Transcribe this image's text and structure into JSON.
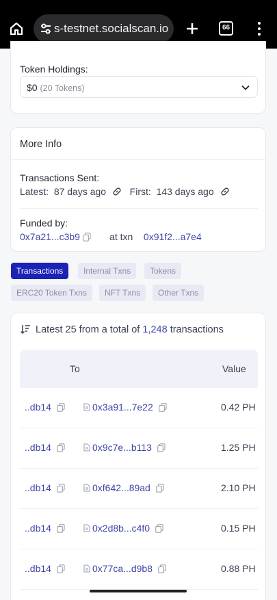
{
  "browser": {
    "url": "s-testnet.socialscan.io",
    "tab_count": "66",
    "icons": [
      "home-icon",
      "tune-icon",
      "plus-icon",
      "tab-switcher-icon",
      "more-vertical-icon"
    ]
  },
  "token_holdings": {
    "label": "Token Holdings:",
    "value": "$0",
    "count": "(20 Tokens)"
  },
  "more_info": {
    "title": "More Info",
    "tx_sent_label": "Transactions Sent:",
    "latest_label": "Latest:",
    "latest_value": "87 days ago",
    "first_label": "First:",
    "first_value": "143 days ago",
    "funded_label": "Funded by:",
    "funded_address": "0x7a21...c3b9",
    "at_txn_label": "at txn",
    "funded_txn": "0x91f2...a7e4"
  },
  "tabs": [
    {
      "label": "Transactions",
      "active": true
    },
    {
      "label": "Internal Txns",
      "active": false
    },
    {
      "label": "Tokens",
      "active": false
    },
    {
      "label": "ERC20 Token Txns",
      "active": false
    },
    {
      "label": "NFT Txns",
      "active": false
    },
    {
      "label": "Other Txns",
      "active": false
    }
  ],
  "transactions": {
    "summary_prefix": "Latest 25 from a total of",
    "total": "1,248",
    "summary_suffix": "transactions",
    "columns": {
      "to": "To",
      "value": "Value"
    },
    "rows": [
      {
        "from": "..db14",
        "to": "0x3a91...7e22",
        "value": "0.42 PH"
      },
      {
        "from": "..db14",
        "to": "0x9c7e...b113",
        "value": "1.25 PH"
      },
      {
        "from": "..db14",
        "to": "0xf642...89ad",
        "value": "2.10 PH"
      },
      {
        "from": "..db14",
        "to": "0x2d8b...c4f0",
        "value": "0.15 PH"
      },
      {
        "from": "..db14",
        "to": "0x77ca...d9b8",
        "value": "0.88 PH"
      }
    ]
  },
  "colors": {
    "accent": "#1a23b4",
    "link": "#3e46a6"
  }
}
